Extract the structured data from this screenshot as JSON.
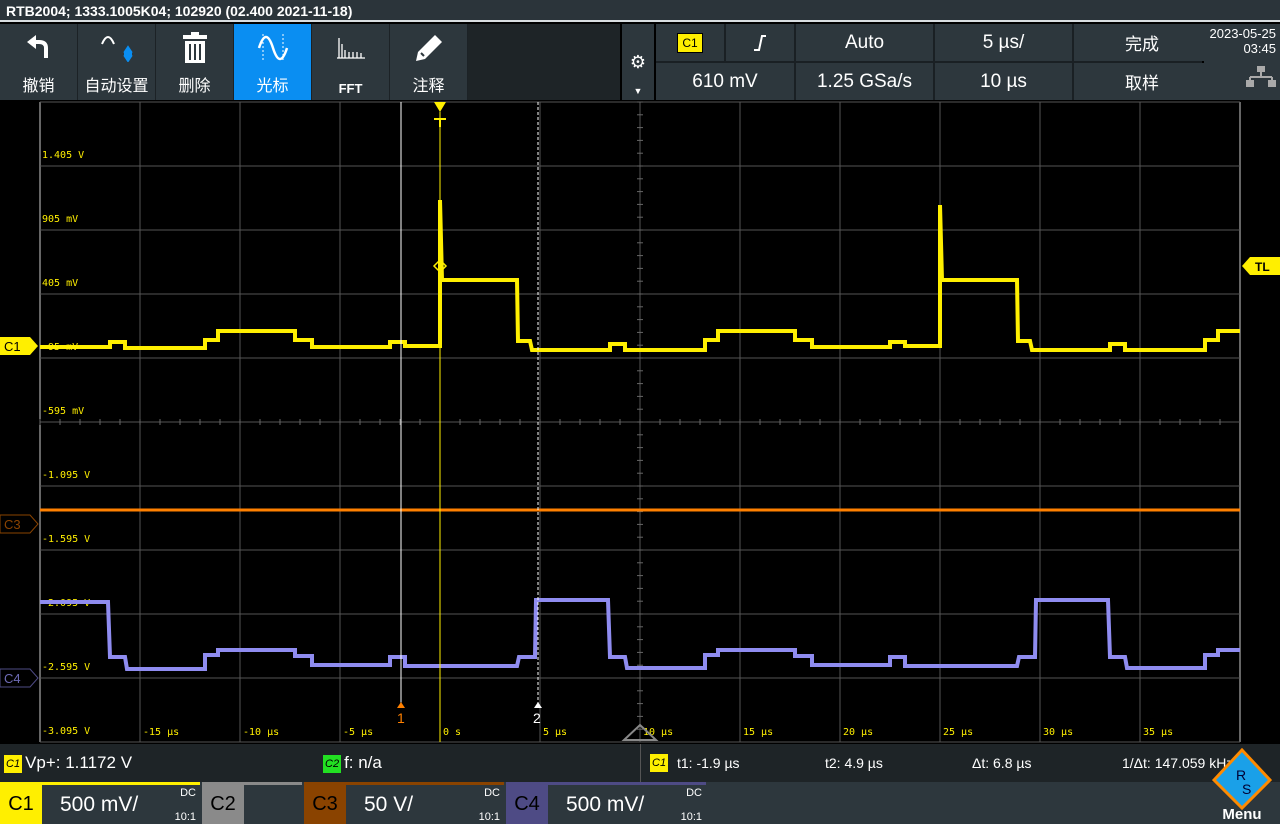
{
  "title": "RTB2004; 1333.1005K04; 102920 (02.400 2021-11-18)",
  "toolbar": [
    {
      "icon": "undo-icon",
      "label": "撤销"
    },
    {
      "icon": "autoset-icon",
      "label": "自动设置"
    },
    {
      "icon": "trash-icon",
      "label": "删除"
    },
    {
      "icon": "cursor-sine-icon",
      "label": "光标",
      "active": true
    },
    {
      "icon": "fft-icon",
      "label": "FFT"
    },
    {
      "icon": "pencil-icon",
      "label": "注释"
    }
  ],
  "info": {
    "trig_source": "C1",
    "trig_slope": "⎍",
    "trig_mode": "Auto",
    "timebase": "5 µs/",
    "status": "完成",
    "trig_level": "610 mV",
    "sample_rate": "1.25 GSa/s",
    "record": "10 µs",
    "acq_mode": "取样"
  },
  "datetime": {
    "date": "2023-05-25",
    "time": "03:45"
  },
  "axis": {
    "y_labels": [
      "1.405 V",
      "905 mV",
      "405 mV",
      "-95 mV",
      "-595 mV",
      "-1.095 V",
      "-1.595 V",
      "-2.095 V",
      "-2.595 V",
      "-3.095 V"
    ],
    "x_labels": [
      "-15 µs",
      "-10 µs",
      "-5 µs",
      "0 s",
      "5 µs",
      "10 µs",
      "15 µs",
      "20 µs",
      "25 µs",
      "30 µs",
      "35 µs"
    ]
  },
  "markers": {
    "c1": "C1",
    "c3": "C3",
    "c4": "C4",
    "tl": "TL",
    "cursor1": "1",
    "cursor2": "2"
  },
  "measure": {
    "m1_src": "C1",
    "m1": "Vp+: 1.1172 V",
    "m2_src": "C2",
    "m2": "f: n/a",
    "cur_src": "C1",
    "t1": "t1: -1.9 µs",
    "t2": "t2: 4.9 µs",
    "dt": "Δt: 6.8 µs",
    "inv_dt": "1/Δt: 147.059 kHz"
  },
  "channels": [
    {
      "name": "C1",
      "scale": "500 mV/",
      "coupling": "DC",
      "probe": "10:1",
      "color": "#ffef00"
    },
    {
      "name": "C2",
      "scale": "",
      "coupling": "",
      "probe": "",
      "color": "#8a8a8a"
    },
    {
      "name": "C3",
      "scale": "50 V/",
      "coupling": "DC",
      "probe": "10:1",
      "color": "#8a4300"
    },
    {
      "name": "C4",
      "scale": "500 mV/",
      "coupling": "DC",
      "probe": "10:1",
      "color": "#4e4b85"
    }
  ],
  "menu_label": "Menu",
  "colors": {
    "c1": "#ffef00",
    "c3": "#ff8000",
    "c4": "#8f8cf0",
    "accent": "#0a8ef2"
  }
}
